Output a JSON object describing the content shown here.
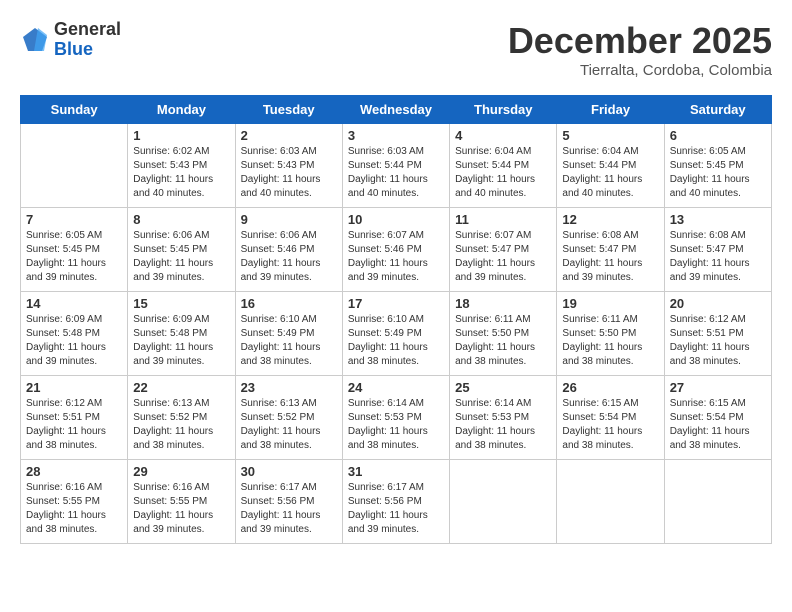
{
  "header": {
    "logo_general": "General",
    "logo_blue": "Blue",
    "month_title": "December 2025",
    "location": "Tierralta, Cordoba, Colombia"
  },
  "weekdays": [
    "Sunday",
    "Monday",
    "Tuesday",
    "Wednesday",
    "Thursday",
    "Friday",
    "Saturday"
  ],
  "weeks": [
    [
      {
        "day": "",
        "info": ""
      },
      {
        "day": "1",
        "info": "Sunrise: 6:02 AM\nSunset: 5:43 PM\nDaylight: 11 hours and 40 minutes."
      },
      {
        "day": "2",
        "info": "Sunrise: 6:03 AM\nSunset: 5:43 PM\nDaylight: 11 hours and 40 minutes."
      },
      {
        "day": "3",
        "info": "Sunrise: 6:03 AM\nSunset: 5:44 PM\nDaylight: 11 hours and 40 minutes."
      },
      {
        "day": "4",
        "info": "Sunrise: 6:04 AM\nSunset: 5:44 PM\nDaylight: 11 hours and 40 minutes."
      },
      {
        "day": "5",
        "info": "Sunrise: 6:04 AM\nSunset: 5:44 PM\nDaylight: 11 hours and 40 minutes."
      },
      {
        "day": "6",
        "info": "Sunrise: 6:05 AM\nSunset: 5:45 PM\nDaylight: 11 hours and 40 minutes."
      }
    ],
    [
      {
        "day": "7",
        "info": "Sunrise: 6:05 AM\nSunset: 5:45 PM\nDaylight: 11 hours and 39 minutes."
      },
      {
        "day": "8",
        "info": "Sunrise: 6:06 AM\nSunset: 5:45 PM\nDaylight: 11 hours and 39 minutes."
      },
      {
        "day": "9",
        "info": "Sunrise: 6:06 AM\nSunset: 5:46 PM\nDaylight: 11 hours and 39 minutes."
      },
      {
        "day": "10",
        "info": "Sunrise: 6:07 AM\nSunset: 5:46 PM\nDaylight: 11 hours and 39 minutes."
      },
      {
        "day": "11",
        "info": "Sunrise: 6:07 AM\nSunset: 5:47 PM\nDaylight: 11 hours and 39 minutes."
      },
      {
        "day": "12",
        "info": "Sunrise: 6:08 AM\nSunset: 5:47 PM\nDaylight: 11 hours and 39 minutes."
      },
      {
        "day": "13",
        "info": "Sunrise: 6:08 AM\nSunset: 5:47 PM\nDaylight: 11 hours and 39 minutes."
      }
    ],
    [
      {
        "day": "14",
        "info": "Sunrise: 6:09 AM\nSunset: 5:48 PM\nDaylight: 11 hours and 39 minutes."
      },
      {
        "day": "15",
        "info": "Sunrise: 6:09 AM\nSunset: 5:48 PM\nDaylight: 11 hours and 39 minutes."
      },
      {
        "day": "16",
        "info": "Sunrise: 6:10 AM\nSunset: 5:49 PM\nDaylight: 11 hours and 38 minutes."
      },
      {
        "day": "17",
        "info": "Sunrise: 6:10 AM\nSunset: 5:49 PM\nDaylight: 11 hours and 38 minutes."
      },
      {
        "day": "18",
        "info": "Sunrise: 6:11 AM\nSunset: 5:50 PM\nDaylight: 11 hours and 38 minutes."
      },
      {
        "day": "19",
        "info": "Sunrise: 6:11 AM\nSunset: 5:50 PM\nDaylight: 11 hours and 38 minutes."
      },
      {
        "day": "20",
        "info": "Sunrise: 6:12 AM\nSunset: 5:51 PM\nDaylight: 11 hours and 38 minutes."
      }
    ],
    [
      {
        "day": "21",
        "info": "Sunrise: 6:12 AM\nSunset: 5:51 PM\nDaylight: 11 hours and 38 minutes."
      },
      {
        "day": "22",
        "info": "Sunrise: 6:13 AM\nSunset: 5:52 PM\nDaylight: 11 hours and 38 minutes."
      },
      {
        "day": "23",
        "info": "Sunrise: 6:13 AM\nSunset: 5:52 PM\nDaylight: 11 hours and 38 minutes."
      },
      {
        "day": "24",
        "info": "Sunrise: 6:14 AM\nSunset: 5:53 PM\nDaylight: 11 hours and 38 minutes."
      },
      {
        "day": "25",
        "info": "Sunrise: 6:14 AM\nSunset: 5:53 PM\nDaylight: 11 hours and 38 minutes."
      },
      {
        "day": "26",
        "info": "Sunrise: 6:15 AM\nSunset: 5:54 PM\nDaylight: 11 hours and 38 minutes."
      },
      {
        "day": "27",
        "info": "Sunrise: 6:15 AM\nSunset: 5:54 PM\nDaylight: 11 hours and 38 minutes."
      }
    ],
    [
      {
        "day": "28",
        "info": "Sunrise: 6:16 AM\nSunset: 5:55 PM\nDaylight: 11 hours and 38 minutes."
      },
      {
        "day": "29",
        "info": "Sunrise: 6:16 AM\nSunset: 5:55 PM\nDaylight: 11 hours and 39 minutes."
      },
      {
        "day": "30",
        "info": "Sunrise: 6:17 AM\nSunset: 5:56 PM\nDaylight: 11 hours and 39 minutes."
      },
      {
        "day": "31",
        "info": "Sunrise: 6:17 AM\nSunset: 5:56 PM\nDaylight: 11 hours and 39 minutes."
      },
      {
        "day": "",
        "info": ""
      },
      {
        "day": "",
        "info": ""
      },
      {
        "day": "",
        "info": ""
      }
    ]
  ]
}
